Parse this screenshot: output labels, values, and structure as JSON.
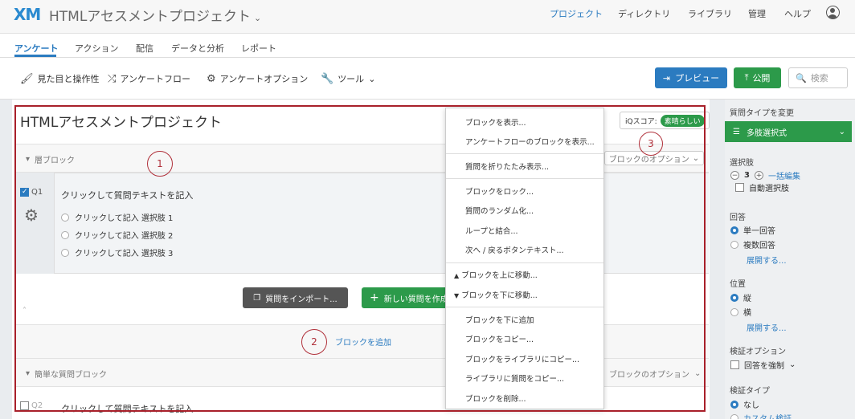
{
  "header": {
    "logo": "XM",
    "project_title": "HTMLアセスメントプロジェクト",
    "nav": [
      "プロジェクト",
      "ディレクトリ",
      "ライブラリ",
      "管理",
      "ヘルプ"
    ]
  },
  "tabs": [
    "アンケート",
    "アクション",
    "配信",
    "データと分析",
    "レポート"
  ],
  "toolbar": {
    "look_feel": "見た目と操作性",
    "flow": "アンケートフロー",
    "options": "アンケートオプション",
    "tools": "ツール",
    "preview": "プレビュー",
    "publish": "公開",
    "search_placeholder": "検索"
  },
  "survey": {
    "title": "HTMLアセスメントプロジェクト",
    "iq_label": "iQスコア:",
    "iq_value": "素晴らしい",
    "block1": {
      "name": "層ブロック",
      "options": "ブロックのオプション",
      "question": {
        "id": "Q1",
        "text": "クリックして質問テキストを記入",
        "choices": [
          "クリックして記入 選択肢 1",
          "クリックして記入 選択肢 2",
          "クリックして記入 選択肢 3"
        ]
      }
    },
    "import_btn": "質問をインポート...",
    "new_btn": "新しい質問を作成",
    "add_block": "ブロックを追加",
    "block2": {
      "name": "簡単な質問ブロック",
      "options": "ブロックのオプション",
      "question": {
        "id": "Q2",
        "text": "クリックして質問テキストを記入"
      }
    }
  },
  "annotations": [
    "1",
    "2",
    "3"
  ],
  "menu": [
    [
      "ブロックを表示...",
      "アンケートフローのブロックを表示..."
    ],
    [
      "質問を折りたたみ表示..."
    ],
    [
      "ブロックをロック...",
      "質問のランダム化...",
      "ループと結合...",
      "次へ / 戻るボタンテキスト..."
    ],
    [
      "ブロックを上に移動...",
      "ブロックを下に移動..."
    ],
    [
      "ブロックを下に追加",
      "ブロックをコピー...",
      "ブロックをライブラリにコピー...",
      "ライブラリに質問をコピー...",
      "ブロックを削除..."
    ]
  ],
  "sidebar": {
    "change_type": "質問タイプを変更",
    "type_value": "多肢選択式",
    "choices_label": "選択肢",
    "choices_count": "3",
    "bulk_edit": "一括編集",
    "auto_choice": "自動選択肢",
    "answer_label": "回答",
    "single": "単一回答",
    "multiple": "複数回答",
    "expand1": "展開する...",
    "position_label": "位置",
    "vertical": "縦",
    "horizontal": "横",
    "expand2": "展開する...",
    "validation_opt": "検証オプション",
    "force": "回答を強制",
    "validation_type": "検証タイプ",
    "none": "なし",
    "custom": "カスタム検証"
  },
  "colors": {
    "accent": "#2b7bc0",
    "green": "#2c9a4a",
    "annotation_red": "#a8202a"
  }
}
